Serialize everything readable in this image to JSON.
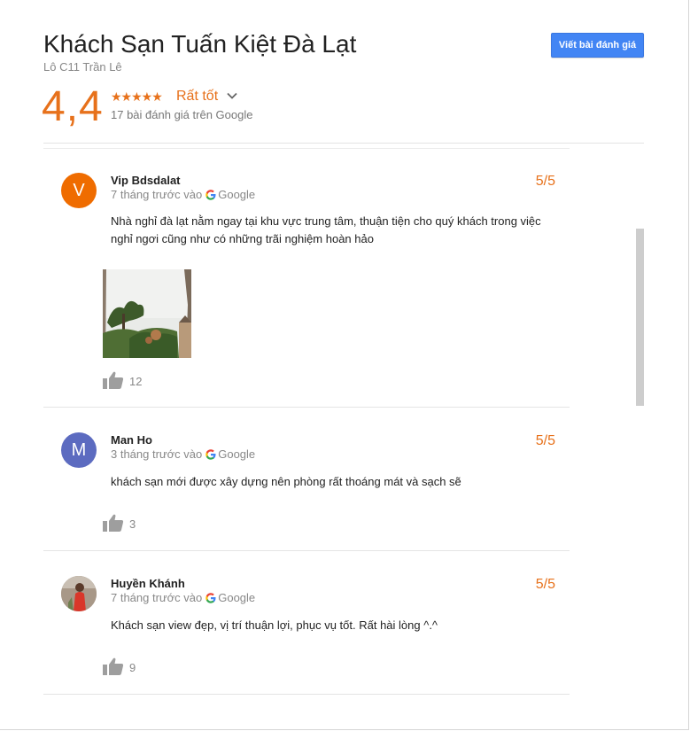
{
  "header": {
    "title": "Khách Sạn Tuấn Kiệt Đà Lạt",
    "address": "Lô C11 Trần Lê",
    "write_review_label": "Viết bài đánh giá",
    "rating": "4,4",
    "stars": "★★★★★",
    "rating_label": "Rất tốt",
    "review_count": "17 bài đánh giá trên Google"
  },
  "colors": {
    "accent": "#e7711b",
    "button": "#4285f4"
  },
  "reviews": [
    {
      "author": "Vip Bdsdalat",
      "avatar_letter": "V",
      "avatar_color": "#ef6c00",
      "time": "7 tháng trước vào",
      "source": "Google",
      "score": "5/5",
      "text": "Nhà nghỉ đà lạt nằm ngay tại khu vực trung tâm, thuận tiện cho quý khách trong việc nghỉ ngơi cũng như có những trãi nghiệm hoàn hảo",
      "likes": "12"
    },
    {
      "author": "Man Ho",
      "avatar_letter": "M",
      "avatar_color": "#5c6bc0",
      "time": "3 tháng trước vào",
      "source": "Google",
      "score": "5/5",
      "text": "khách sạn mới được xây dựng nên phòng rất thoáng mát và sạch sẽ",
      "likes": "3"
    },
    {
      "author": "Huyền Khánh",
      "avatar_letter": "",
      "avatar_color": "#8d7b6a",
      "time": "7 tháng trước vào",
      "source": "Google",
      "score": "5/5",
      "text": "Khách sạn view đẹp, vị trí thuận lợi, phục vụ tốt. Rất hài lòng ^.^",
      "likes": "9"
    }
  ]
}
